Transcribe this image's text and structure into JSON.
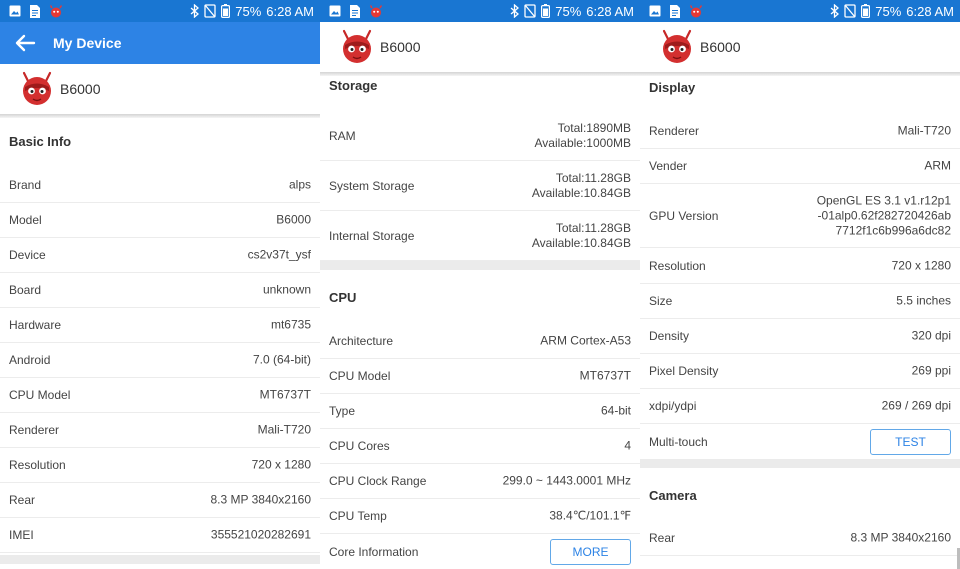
{
  "status": {
    "battery": "75%",
    "time": "6:28 AM"
  },
  "colors": {
    "statusbar": "#1976D2",
    "toolbar": "#2D83E5",
    "accent": "#2D83E5",
    "logo_red": "#D32F2F"
  },
  "panel1": {
    "toolbar_title": "My Device",
    "device_name": "B6000",
    "section_title": "Basic Info",
    "rows": [
      {
        "label": "Brand",
        "value": "alps"
      },
      {
        "label": "Model",
        "value": "B6000"
      },
      {
        "label": "Device",
        "value": "cs2v37t_ysf"
      },
      {
        "label": "Board",
        "value": "unknown"
      },
      {
        "label": "Hardware",
        "value": "mt6735"
      },
      {
        "label": "Android",
        "value": "7.0 (64-bit)"
      },
      {
        "label": "CPU Model",
        "value": "MT6737T"
      },
      {
        "label": "Renderer",
        "value": "Mali-T720"
      },
      {
        "label": "Resolution",
        "value": "720 x 1280"
      },
      {
        "label": "Rear",
        "value": "8.3 MP 3840x2160"
      },
      {
        "label": "IMEI",
        "value": "355521020282691"
      }
    ]
  },
  "panel2": {
    "device_name": "B6000",
    "storage_title": "Storage",
    "storage_rows": [
      {
        "label": "RAM",
        "line1": "Total:1890MB",
        "line2": "Available:1000MB"
      },
      {
        "label": "System Storage",
        "line1": "Total:11.28GB",
        "line2": "Available:10.84GB"
      },
      {
        "label": "Internal Storage",
        "line1": "Total:11.28GB",
        "line2": "Available:10.84GB"
      }
    ],
    "cpu_title": "CPU",
    "cpu_rows": [
      {
        "label": "Architecture",
        "value": "ARM Cortex-A53"
      },
      {
        "label": "CPU Model",
        "value": "MT6737T"
      },
      {
        "label": "Type",
        "value": "64-bit"
      },
      {
        "label": "CPU Cores",
        "value": "4"
      },
      {
        "label": "CPU Clock Range",
        "value": "299.0 ~ 1443.0001 MHz"
      },
      {
        "label": "CPU Temp",
        "value": "38.4℃/101.1℉"
      }
    ],
    "core_info_label": "Core Information",
    "more_button": "MORE"
  },
  "panel3": {
    "device_name": "B6000",
    "display_title": "Display",
    "rows_a": [
      {
        "label": "Renderer",
        "value": "Mali-T720"
      },
      {
        "label": "Vender",
        "value": "ARM"
      }
    ],
    "gpu_label": "GPU Version",
    "gpu_lines": [
      "OpenGL ES 3.1 v1.r12p1",
      "-01alp0.62f282720426ab",
      "7712f1c6b996a6dc82"
    ],
    "rows_b": [
      {
        "label": "Resolution",
        "value": "720 x 1280"
      },
      {
        "label": "Size",
        "value": "5.5 inches"
      },
      {
        "label": "Density",
        "value": "320 dpi"
      },
      {
        "label": "Pixel Density",
        "value": "269 ppi"
      },
      {
        "label": "xdpi/ydpi",
        "value": "269 / 269 dpi"
      }
    ],
    "multitouch_label": "Multi-touch",
    "test_button": "TEST",
    "camera_title": "Camera",
    "camera_rows": [
      {
        "label": "Rear",
        "value": "8.3 MP 3840x2160"
      }
    ]
  }
}
